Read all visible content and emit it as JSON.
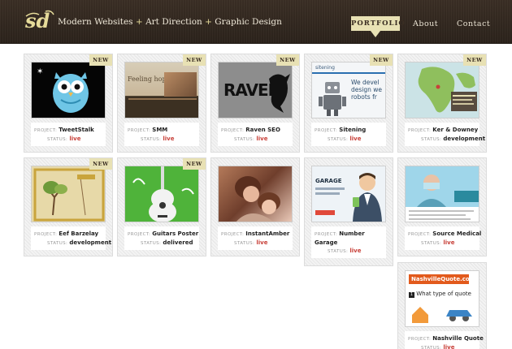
{
  "header": {
    "logo_text": "sd",
    "tagline_parts": [
      "Modern Websites",
      "+",
      "Art Direction",
      "+",
      "Graphic Design"
    ],
    "nav": [
      {
        "label": "PORTFOLIO",
        "active": true
      },
      {
        "label": "About",
        "active": false
      },
      {
        "label": "Contact",
        "active": false
      }
    ]
  },
  "labels": {
    "project": "PROJECT:",
    "status": "STATUS:",
    "new_badge": "NEW"
  },
  "projects": [
    {
      "name": "TweetStalk",
      "status": "live",
      "is_new": true,
      "thumb_text": ""
    },
    {
      "name": "SMM",
      "status": "live",
      "is_new": true,
      "thumb_text": "Feeling hopeless?"
    },
    {
      "name": "Raven SEO",
      "status": "live",
      "is_new": true,
      "thumb_text": "RAVEN"
    },
    {
      "name": "Sitening",
      "status": "live",
      "is_new": true,
      "thumb_text": "sitening",
      "thumb_text2": "We devel design we robots fr"
    },
    {
      "name": "Ker & Downey",
      "status": "development",
      "is_new": true,
      "thumb_text": ""
    },
    {
      "name": "Eef Barzelay",
      "status": "development",
      "is_new": true,
      "thumb_text": ""
    },
    {
      "name": "Guitars Poster",
      "status": "delivered",
      "is_new": true,
      "thumb_text": ""
    },
    {
      "name": "InstantAmber",
      "status": "live",
      "is_new": false,
      "thumb_text": ""
    },
    {
      "name": "Number Garage",
      "status": "live",
      "is_new": false,
      "thumb_text": "GARAGE"
    },
    {
      "name": "Source Medical",
      "status": "live",
      "is_new": false,
      "thumb_text": ""
    },
    {
      "name": "Nashville Quote",
      "status": "live",
      "is_new": false,
      "thumb_text": "NashvilleQuote.com",
      "thumb_text2": "What type of quote"
    }
  ]
}
